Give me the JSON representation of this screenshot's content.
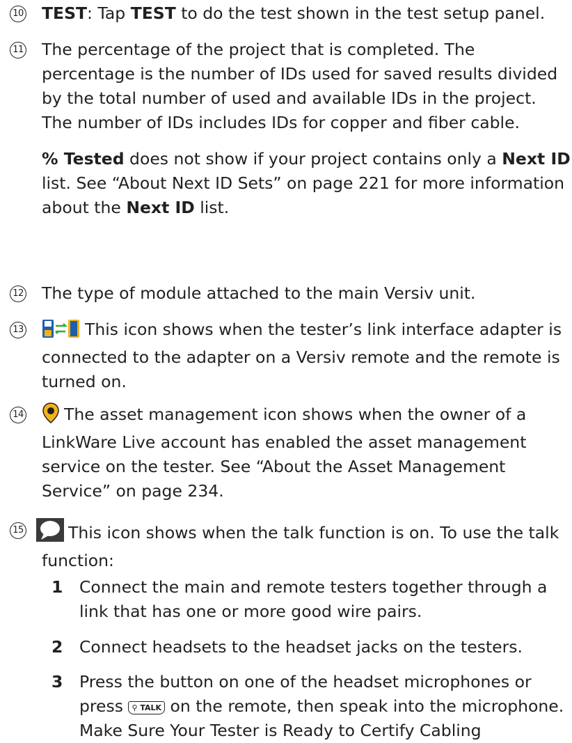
{
  "items": [
    {
      "num": "10",
      "lead_bold": "TEST",
      "text_a": ": Tap ",
      "inline_bold": "TEST",
      "text_b": " to do the test shown in the test setup panel."
    },
    {
      "num": "11",
      "text": "The percentage of the project that is completed. The percentage is the number of IDs used for saved results divided by the total number of used and available IDs in the project. The number of IDs includes IDs for copper and fiber cable.",
      "note_bold_a": " % Tested",
      "note_a": " does not show if your project contains only a ",
      "note_bold_b": "Next ID",
      "note_b": " list. See “About Next ID Sets” on page 221 for more information about the ",
      "note_bold_c": "Next ID",
      "note_c": " list."
    },
    {
      "num": "12",
      "text": "The type of module attached to the main Versiv unit."
    },
    {
      "num": "13",
      "icon": "remote-connected-icon",
      "text": "This icon shows when the tester’s link interface adapter is connected to the adapter on a Versiv remote and the remote is turned on."
    },
    {
      "num": "14",
      "icon": "asset-management-icon",
      "text": "The asset management icon shows when the owner of a LinkWare Live account has enabled the asset management service on the tester. See “About the Asset Management Service” on page 234."
    },
    {
      "num": "15",
      "icon": "talk-bubble-icon",
      "text": "This icon shows when the talk function is on. To use the talk function:"
    }
  ],
  "steps": [
    {
      "num": "1",
      "text": "Connect the main and remote testers together through a link that has one or more good wire pairs."
    },
    {
      "num": "2",
      "text": "Connect headsets to the headset jacks on the testers."
    },
    {
      "num": "3",
      "text_a": "Press the button on one of the headset microphones or press ",
      "key_label": "TALK",
      "text_b": " on the remote, then speak into the microphone. Make Sure Your Tester is Ready to Certify Cabling"
    }
  ],
  "colors": {
    "text": "#231f20",
    "remote_blue": "#1f5fa8",
    "remote_yellow": "#f2b21c",
    "arrow_green": "#39a935",
    "bubble": "#3a3a3a"
  }
}
